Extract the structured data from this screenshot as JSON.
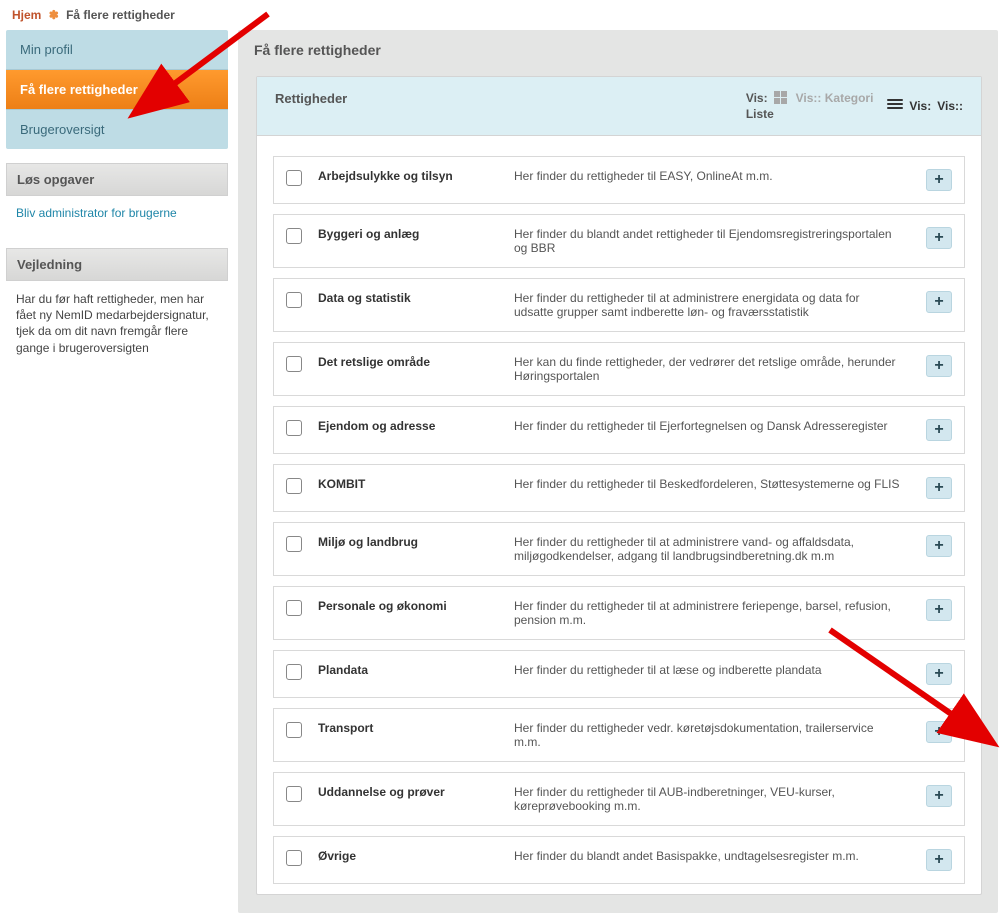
{
  "breadcrumb": {
    "home": "Hjem",
    "current": "Få flere rettigheder"
  },
  "sidebar": {
    "nav": [
      {
        "label": "Min profil"
      },
      {
        "label": "Få flere rettigheder",
        "active": true
      },
      {
        "label": "Brugeroversigt"
      }
    ],
    "tasks_title": "Løs opgaver",
    "tasks_link": "Bliv administrator for brugerne",
    "guide_title": "Vejledning",
    "guide_body": "Har du før haft rettigheder, men har fået ny NemID medarbejdersignatur, tjek da om dit navn fremgår flere gange i brugeroversigten"
  },
  "main": {
    "page_title": "Få flere rettigheder",
    "panel_title": "Rettigheder",
    "vis_label": "Vis:",
    "vis_kategori": "Vis:: Kategori",
    "vis_liste": "Vis:: Liste",
    "liste_word": "Liste",
    "rows": [
      {
        "title": "Arbejdsulykke og tilsyn",
        "desc": "Her finder du rettigheder til EASY, OnlineAt m.m."
      },
      {
        "title": "Byggeri og anlæg",
        "desc": "Her finder du blandt andet rettigheder til Ejendomsregistreringsportalen og BBR"
      },
      {
        "title": "Data og statistik",
        "desc": "Her finder du rettigheder til at administrere energidata og data for udsatte grupper samt indberette løn- og fraværsstatistik"
      },
      {
        "title": "Det retslige område",
        "desc": "Her kan du finde rettigheder, der vedrører det retslige område, herunder Høringsportalen"
      },
      {
        "title": "Ejendom og adresse",
        "desc": "Her finder du rettigheder til Ejerfortegnelsen og Dansk Adresseregister"
      },
      {
        "title": "KOMBIT",
        "desc": "Her finder du rettigheder til Beskedfordeleren, Støttesystemerne og FLIS"
      },
      {
        "title": "Miljø og landbrug",
        "desc": "Her finder du rettigheder til at administrere vand- og affaldsdata, miljøgodkendelser, adgang til landbrugsindberetning.dk m.m"
      },
      {
        "title": "Personale og økonomi",
        "desc": "Her finder du rettigheder til at administrere feriepenge, barsel, refusion, pension m.m."
      },
      {
        "title": "Plandata",
        "desc": "Her finder du rettigheder til at læse og indberette plandata"
      },
      {
        "title": "Transport",
        "desc": "Her finder du rettigheder vedr. køretøjsdokumentation, trailerservice m.m."
      },
      {
        "title": "Uddannelse og prøver",
        "desc": "Her finder du rettigheder til AUB-indberetninger, VEU-kurser, køreprøvebooking m.m."
      },
      {
        "title": "Øvrige",
        "desc": "Her finder du blandt andet Basispakke, undtagelsesregister m.m."
      }
    ],
    "expand_symbol": "+"
  }
}
